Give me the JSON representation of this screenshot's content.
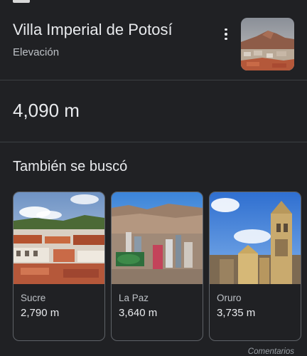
{
  "header": {
    "title": "Villa Imperial de Potosí",
    "subtitle": "Elevación",
    "more_icon": "more-vert-icon"
  },
  "answer": {
    "value": "4,090 m"
  },
  "related": {
    "heading": "También se buscó",
    "items": [
      {
        "name": "Sucre",
        "value": "2,790 m"
      },
      {
        "name": "La Paz",
        "value": "3,640 m"
      },
      {
        "name": "Oruro",
        "value": "3,735 m"
      }
    ]
  },
  "footer": {
    "feedback_label": "Comentarios"
  },
  "colors": {
    "background": "#202124",
    "divider": "#3c4043",
    "card_border": "#5f6368",
    "primary_text": "#e8eaed",
    "secondary_text": "#bdc1c6"
  }
}
